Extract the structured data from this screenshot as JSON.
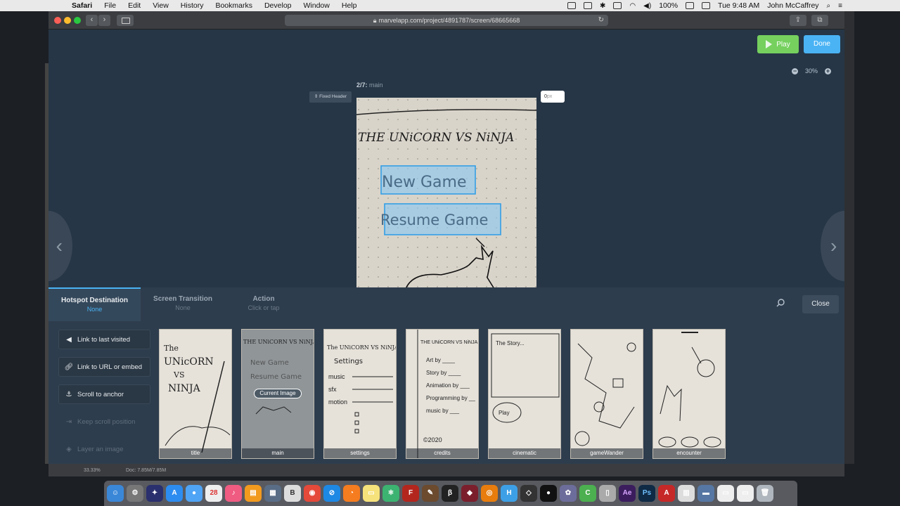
{
  "menubar": {
    "app": "Safari",
    "items": [
      "File",
      "Edit",
      "View",
      "History",
      "Bookmarks",
      "Develop",
      "Window",
      "Help"
    ],
    "battery": "100%",
    "clock": "Tue 9:48 AM",
    "user": "John McCaffrey"
  },
  "browser": {
    "url": "marvelapp.com/project/4891787/screen/68665668"
  },
  "toolbar": {
    "play_label": "Play",
    "done_label": "Done",
    "zoom_level": "30%"
  },
  "screen": {
    "position": "2/7:",
    "name": "main",
    "fixed_header_label": "Fixed Header",
    "offset_value": "0",
    "offset_unit": "px",
    "sketch_title": "THE UNiCORN VS NiNJA",
    "hotspot_1": "New Game",
    "hotspot_2": "Resume Game"
  },
  "panel": {
    "tabs": [
      {
        "label": "Hotspot Destination",
        "value": "None"
      },
      {
        "label": "Screen Transition",
        "value": "None"
      },
      {
        "label": "Action",
        "value": "Click or tap"
      }
    ],
    "close_label": "Close",
    "options": [
      {
        "label": "Link to last visited",
        "icon": "arrow-left-icon"
      },
      {
        "label": "Link to URL or embed",
        "icon": "link-icon"
      },
      {
        "label": "Scroll to anchor",
        "icon": "anchor-icon"
      },
      {
        "label": "Keep scroll position",
        "icon": "scroll-position-icon"
      },
      {
        "label": "Layer an image",
        "icon": "layers-icon"
      }
    ],
    "current_image_label": "Current Image",
    "screens": [
      "title",
      "main",
      "settings",
      "credits",
      "cinematic",
      "gameWander",
      "encounter"
    ]
  },
  "statusbar": {
    "zoom": "33.33%",
    "doc": "Doc: 7.85M/7.85M"
  },
  "colors": {
    "play_green": "#75d05e",
    "done_blue": "#4ab3f4",
    "canvas_bg": "#263646",
    "panel_bg": "#2e3d4d"
  }
}
